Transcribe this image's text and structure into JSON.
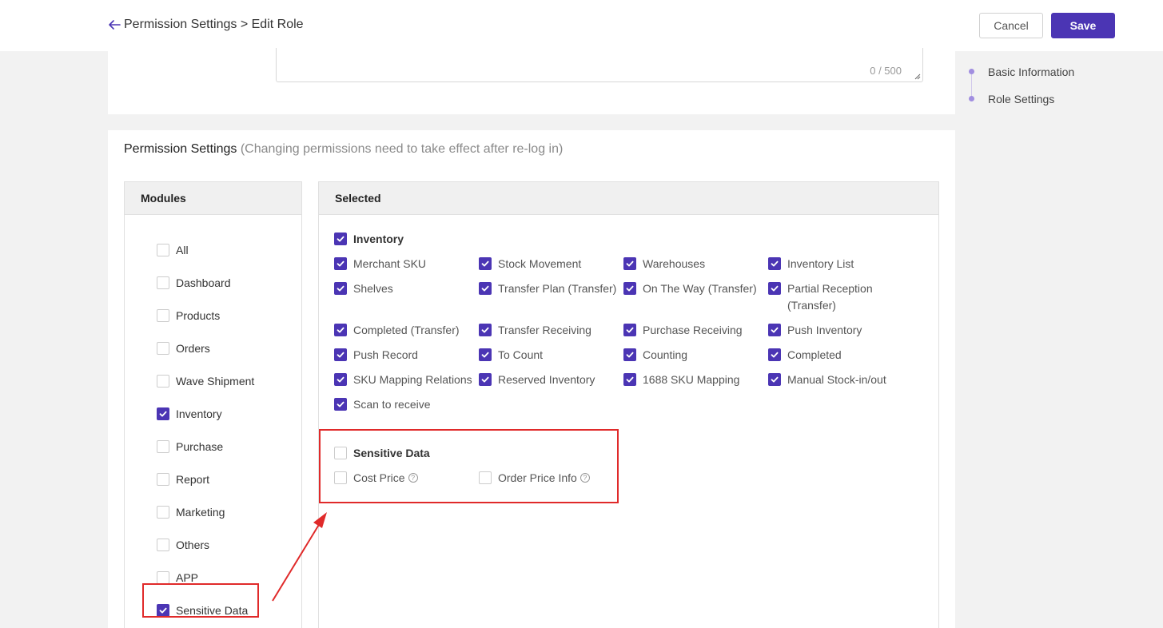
{
  "header": {
    "breadcrumb": "Permission Settings > Edit Role",
    "cancel_label": "Cancel",
    "save_label": "Save"
  },
  "description": {
    "counter": "0 / 500"
  },
  "anchor_nav": [
    "Basic Information",
    "Role Settings"
  ],
  "permission_section": {
    "title": "Permission Settings",
    "note": "(Changing permissions need to take effect after re-log in)",
    "modules_header": "Modules",
    "selected_header": "Selected"
  },
  "modules": [
    {
      "label": "All",
      "checked": false
    },
    {
      "label": "Dashboard",
      "checked": false
    },
    {
      "label": "Products",
      "checked": false
    },
    {
      "label": "Orders",
      "checked": false
    },
    {
      "label": "Wave Shipment",
      "checked": false
    },
    {
      "label": "Inventory",
      "checked": true
    },
    {
      "label": "Purchase",
      "checked": false
    },
    {
      "label": "Report",
      "checked": false
    },
    {
      "label": "Marketing",
      "checked": false
    },
    {
      "label": "Others",
      "checked": false
    },
    {
      "label": "APP",
      "checked": false
    },
    {
      "label": "Sensitive Data",
      "checked": true
    }
  ],
  "inventory_group": {
    "label": "Inventory",
    "checked": true,
    "items": [
      "Merchant SKU",
      "Stock Movement",
      "Warehouses",
      "Inventory List",
      "Shelves",
      "Transfer Plan (Transfer)",
      "On The Way (Transfer)",
      "Partial Reception (Transfer)",
      "Completed (Transfer)",
      "Transfer Receiving",
      "Purchase Receiving",
      "Push Inventory",
      "Push Record",
      "To Count",
      "Counting",
      "Completed",
      "SKU Mapping Relations",
      "Reserved Inventory",
      "1688 SKU Mapping",
      "Manual Stock-in/out",
      "Scan to receive"
    ]
  },
  "sensitive_group": {
    "label": "Sensitive Data",
    "checked": false,
    "items": [
      "Cost Price",
      "Order Price Info"
    ]
  },
  "colors": {
    "accent": "#4b35b4",
    "highlight": "#e02a2a"
  }
}
